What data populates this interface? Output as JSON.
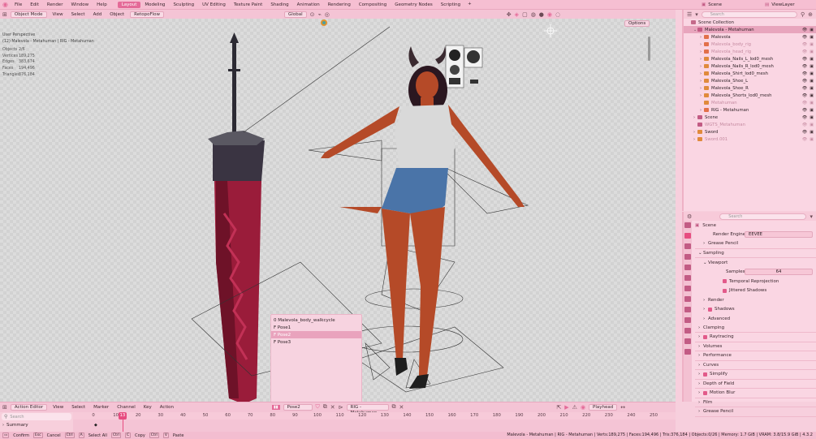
{
  "menu": [
    "File",
    "Edit",
    "Render",
    "Window",
    "Help"
  ],
  "workspaces": [
    {
      "label": "Layout",
      "active": true
    },
    {
      "label": "Modeling",
      "active": false
    },
    {
      "label": "Sculpting",
      "active": false
    },
    {
      "label": "UV Editing",
      "active": false
    },
    {
      "label": "Texture Paint",
      "active": false
    },
    {
      "label": "Shading",
      "active": false
    },
    {
      "label": "Animation",
      "active": false
    },
    {
      "label": "Rendering",
      "active": false
    },
    {
      "label": "Compositing",
      "active": false
    },
    {
      "label": "Geometry Nodes",
      "active": false
    },
    {
      "label": "Scripting",
      "active": false
    }
  ],
  "top_right": {
    "scene": "Scene",
    "view_layer": "ViewLayer"
  },
  "viewport_header": {
    "mode": "Object Mode",
    "view": "View",
    "select": "Select",
    "add": "Add",
    "object": "Object",
    "addon": "RetopoFlow",
    "orientation": "Global",
    "options": "Options"
  },
  "viewport_info": {
    "line1": "User Perspective",
    "line2": "(12) Malevola - Metahuman | RIG - Metahuman",
    "stats": [
      {
        "label": "Objects",
        "value": "2/6"
      },
      {
        "label": "Vertices",
        "value": "189,275"
      },
      {
        "label": "Edges",
        "value": "383,674"
      },
      {
        "label": "Faces",
        "value": "194,496"
      },
      {
        "label": "Triangles",
        "value": "376,184"
      }
    ]
  },
  "action_popup": {
    "items": [
      {
        "label": "0 Malevola_body_walkcycle",
        "selected": false
      },
      {
        "label": "F Pose1",
        "selected": false
      },
      {
        "label": "F Pose2",
        "selected": true
      },
      {
        "label": "F Pose3",
        "selected": false
      }
    ]
  },
  "outliner": {
    "search_placeholder": "Search",
    "rows": [
      {
        "indent": 0,
        "label": "Scene Collection",
        "color": "#c46a8a",
        "arrow": "",
        "hl": false,
        "dim": false
      },
      {
        "indent": 1,
        "label": "Malevola - Metahuman",
        "color": "#c25b84",
        "arrow": "⌄",
        "hl": true,
        "dim": false
      },
      {
        "indent": 2,
        "label": "Malevola",
        "color": "#e2704a",
        "arrow": "›",
        "hl": false,
        "dim": false
      },
      {
        "indent": 2,
        "label": "Malevola_body_rig",
        "color": "#e2704a",
        "arrow": "›",
        "hl": false,
        "dim": true
      },
      {
        "indent": 2,
        "label": "Malevola_head_rig",
        "color": "#e2704a",
        "arrow": "›",
        "hl": false,
        "dim": true
      },
      {
        "indent": 2,
        "label": "Malevola_Nails_L_lod0_mesh",
        "color": "#e08a3c",
        "arrow": "›",
        "hl": false,
        "dim": false
      },
      {
        "indent": 2,
        "label": "Malevola_Nails_R_lod0_mesh",
        "color": "#e08a3c",
        "arrow": "›",
        "hl": false,
        "dim": false
      },
      {
        "indent": 2,
        "label": "Malevola_Shirt_lod0_mesh",
        "color": "#e08a3c",
        "arrow": "›",
        "hl": false,
        "dim": false
      },
      {
        "indent": 2,
        "label": "Malevola_Shoe_L",
        "color": "#e08a3c",
        "arrow": "›",
        "hl": false,
        "dim": false
      },
      {
        "indent": 2,
        "label": "Malevola_Shoe_R",
        "color": "#e08a3c",
        "arrow": "›",
        "hl": false,
        "dim": false
      },
      {
        "indent": 2,
        "label": "Malevola_Shorts_lod0_mesh",
        "color": "#e08a3c",
        "arrow": "›",
        "hl": false,
        "dim": false
      },
      {
        "indent": 2,
        "label": "Metahuman",
        "color": "#e08a3c",
        "arrow": "",
        "hl": false,
        "dim": true
      },
      {
        "indent": 2,
        "label": "RIG - Metahuman",
        "color": "#e2704a",
        "arrow": "›",
        "hl": false,
        "dim": false
      },
      {
        "indent": 1,
        "label": "Scene",
        "color": "#c25b84",
        "arrow": "›",
        "hl": false,
        "dim": false
      },
      {
        "indent": 1,
        "label": "WGTS_Metahuman",
        "color": "#c25b84",
        "arrow": "",
        "hl": false,
        "dim": true
      },
      {
        "indent": 1,
        "label": "Sword",
        "color": "#e08a3c",
        "arrow": "›",
        "hl": false,
        "dim": false
      },
      {
        "indent": 1,
        "label": "Sword.001",
        "color": "#e08a3c",
        "arrow": "›",
        "hl": false,
        "dim": true
      }
    ]
  },
  "properties": {
    "search_placeholder": "Search",
    "context": "Scene",
    "render_engine_label": "Render Engine",
    "render_engine": "EEVEE",
    "samples_label": "Samples",
    "samples": "64",
    "rows": [
      {
        "label": "Grease Pencil",
        "kind": "sec",
        "indent": 1
      },
      {
        "label": "Sampling",
        "kind": "sec-open",
        "indent": 0
      },
      {
        "label": "Viewport",
        "kind": "sub-open",
        "indent": 1
      },
      {
        "label": "Temporal Reprojection",
        "kind": "check",
        "indent": 4
      },
      {
        "label": "Jittered Shadows",
        "kind": "check",
        "indent": 4
      },
      {
        "label": "Render",
        "kind": "sub",
        "indent": 1
      },
      {
        "label": "Shadows",
        "kind": "sub-check",
        "indent": 1
      },
      {
        "label": "Advanced",
        "kind": "sub",
        "indent": 1
      },
      {
        "label": "Clamping",
        "kind": "sec",
        "indent": 0
      },
      {
        "label": "Raytracing",
        "kind": "sec-check",
        "indent": 0
      },
      {
        "label": "Volumes",
        "kind": "sec",
        "indent": 0
      },
      {
        "label": "Performance",
        "kind": "sec",
        "indent": 0
      },
      {
        "label": "Curves",
        "kind": "sec",
        "indent": 0
      },
      {
        "label": "Simplify",
        "kind": "sec-check",
        "indent": 0
      },
      {
        "label": "Depth of Field",
        "kind": "sec",
        "indent": 0
      },
      {
        "label": "Motion Blur",
        "kind": "sec-check",
        "indent": 0
      },
      {
        "label": "Film",
        "kind": "sec",
        "indent": 0
      },
      {
        "label": "Grease Pencil",
        "kind": "sec",
        "indent": 0
      }
    ]
  },
  "timeline": {
    "editor": "Action Editor",
    "view": "View",
    "select": "Select",
    "marker": "Marker",
    "channel": "Channel",
    "key": "Key",
    "action_menu": "Action",
    "action": "Pose2",
    "rig": "RIG - Metahuman",
    "playhead": "Playhead",
    "search_placeholder": "Search",
    "summary": "Summary",
    "current_frame": "13",
    "ticks": [
      "0",
      "10",
      "20",
      "30",
      "40",
      "50",
      "60",
      "70",
      "80",
      "90",
      "100",
      "110",
      "120",
      "130",
      "140",
      "150",
      "160",
      "170",
      "180",
      "190",
      "200",
      "210",
      "220",
      "230",
      "240",
      "250"
    ]
  },
  "statusbar": {
    "confirm": "Confirm",
    "cancel": "Cancel",
    "select_all": "Select All",
    "copy": "Copy",
    "paste": "Paste",
    "info": "Malevola - Metahuman | RIG - Metahuman | Verts:189,275 | Faces:194,496 | Tris:376,184 | Objects:0/26 | Memory: 1.7 GiB | VRAM: 3.8/15.9 GiB | 4.3.2"
  }
}
